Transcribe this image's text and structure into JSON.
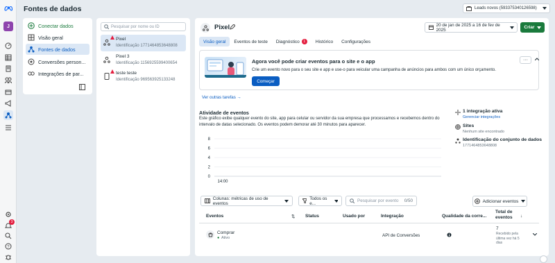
{
  "app": {
    "title": "Fontes de dados"
  },
  "account": {
    "label": "Leads novos (593375340126598)"
  },
  "rail": {
    "avatar_initial": "J",
    "notification_count": "3"
  },
  "left_nav": {
    "connect": "Conectar dados",
    "items": [
      "Visão geral",
      "Fontes de dados",
      "Conversões person...",
      "Integrações de par..."
    ]
  },
  "search": {
    "placeholder": "Pesquisar por nome ou ID"
  },
  "pixels": [
    {
      "name": "Pixel",
      "id": "Identificação 1771464853648808",
      "warning": true
    },
    {
      "name": "Pixel 3",
      "id": "Identificação 1156925599400654",
      "warning": false
    },
    {
      "name": "teste teste",
      "id": "Identificação 969563925133248",
      "warning": true
    }
  ],
  "detail": {
    "title": "Pixel",
    "date_range": "20 de jan de 2025 a 16 de fev de 2025",
    "create_label": "Criar",
    "tabs": [
      "Visão geral",
      "Eventos de teste",
      "Diagnóstico",
      "Histórico",
      "Configurações"
    ],
    "diagnostic_badge": "1"
  },
  "promo": {
    "title": "Agora você pode criar eventos para o site e o app",
    "description": "Crie um evento novo para o seu site e app e use-o para veicular uma campanha de anúncios para ambos com um único orçamento.",
    "button": "Começar",
    "more_tasks": "Ver outras tarefas →"
  },
  "activity": {
    "title": "Atividade de eventos",
    "description": "Este gráfico exibe qualquer evento do site, app para celular ou servidor da sua empresa que processamos e recebemos dentro do intervalo de datas selecionado. Os eventos podem demorar até 30 minutos para aparecer."
  },
  "chart_data": {
    "type": "line",
    "x": [
      "14:00"
    ],
    "series": [
      {
        "values": []
      }
    ],
    "yticks": [
      0,
      2,
      4,
      6,
      8
    ],
    "ylim": [
      0,
      8
    ],
    "xlabel": "",
    "ylabel": "",
    "grid": true
  },
  "side_info": {
    "integration": {
      "title": "1 integração ativa",
      "sub": "Gerenciar integrações"
    },
    "sites": {
      "title": "Sites",
      "sub": "Nenhum site encontrado"
    },
    "dataset": {
      "title": "Identificação do conjunto de dados",
      "sub": "1771464853648808"
    }
  },
  "filters": {
    "columns": "Colunas: métricas de uso de eventos",
    "all": "Todos os e...",
    "search_placeholder": "Pesquisar por evento",
    "counter": "0/50",
    "add_events": "Adicionar eventos"
  },
  "table": {
    "headers": {
      "events": "Eventos",
      "status": "Status",
      "used_by": "Usado por",
      "integration": "Integração",
      "quality": "Qualidade da corre...",
      "total": "Total de eventos"
    },
    "rows": [
      {
        "event": "Comprar",
        "status": "Ativo",
        "integration": "API de Conversões",
        "total": "7",
        "total_sub": "Recebido pela última vez há 5 dias"
      }
    ]
  }
}
